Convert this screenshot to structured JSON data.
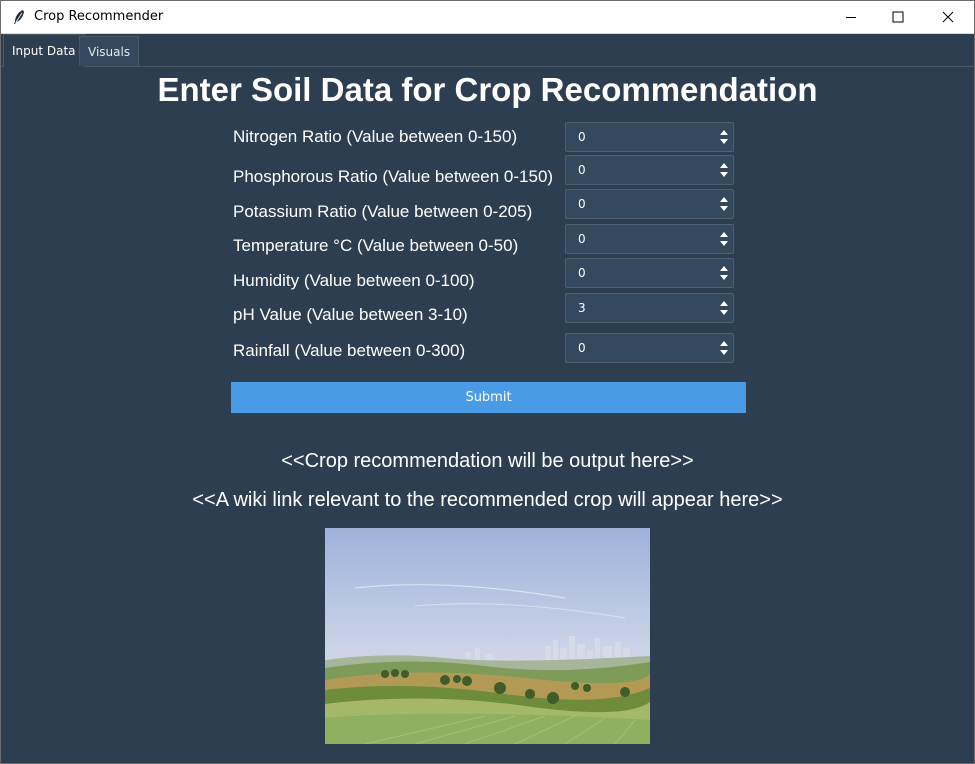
{
  "window": {
    "title": "Crop Recommender"
  },
  "tabs": [
    {
      "label": "Input Data",
      "active": true
    },
    {
      "label": "Visuals",
      "active": false
    }
  ],
  "form": {
    "heading": "Enter Soil Data for Crop Recommendation",
    "fields": [
      {
        "label": "Nitrogen Ratio (Value between 0-150)",
        "value": "0"
      },
      {
        "label": "Phosphorous Ratio (Value between 0-150)",
        "value": "0"
      },
      {
        "label": "Potassium Ratio (Value between 0-205)",
        "value": "0"
      },
      {
        "label": "Temperature °C (Value between 0-50)",
        "value": "0"
      },
      {
        "label": "Humidity (Value between 0-100)",
        "value": "0"
      },
      {
        "label": "pH Value (Value between 3-10)",
        "value": "3"
      },
      {
        "label": "Rainfall (Value between 0-300)",
        "value": "0"
      }
    ],
    "submit_label": "Submit"
  },
  "output": {
    "recommendation_placeholder": "<<Crop recommendation will be output here>>",
    "wiki_placeholder": "<<A wiki link relevant to the recommended crop will appear here>>"
  },
  "colors": {
    "background": "#2c3e50",
    "input_bg": "#34495e",
    "accent": "#4a9be5",
    "text": "#ffffff"
  }
}
